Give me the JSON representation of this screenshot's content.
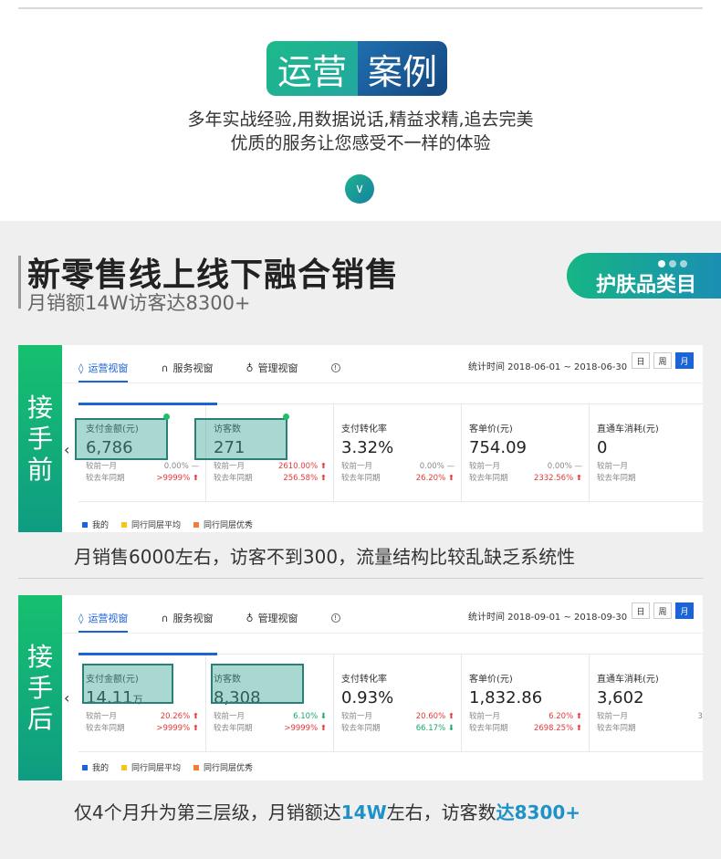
{
  "hero": {
    "badge_left": "运营",
    "badge_right": "案例",
    "subtitle_line1": "多年实战经验,用数据说话,精益求精,追去完美",
    "subtitle_line2": "优质的服务让您感受不一样的体验",
    "down_icon": "∨"
  },
  "section": {
    "title": "新零售线上线下融合销售",
    "subtitle": "月销额14W访客达8300+",
    "tag": "护肤品类目"
  },
  "panels": [
    {
      "side_label": [
        "接",
        "手",
        "前"
      ],
      "tabs": [
        "运营视窗",
        "服务视窗",
        "管理视窗"
      ],
      "stat_time": "统计时间 2018-06-01 ~ 2018-06-30",
      "period_buttons": [
        "日",
        "周",
        "月"
      ],
      "cards": [
        {
          "title": "支付金额(元)",
          "value": "6,786",
          "unit": "",
          "r1_label": "较前一月",
          "r1_val": "0.00%",
          "r1_dir": "—",
          "r2_label": "较去年同期",
          "r2_val": ">9999%",
          "r2_dir": "up"
        },
        {
          "title": "访客数",
          "value": "271",
          "unit": "",
          "r1_label": "较前一月",
          "r1_val": "2610.00%",
          "r1_dir": "up",
          "r2_label": "较去年同期",
          "r2_val": "256.58%",
          "r2_dir": "up"
        },
        {
          "title": "支付转化率",
          "value": "3.32%",
          "unit": "",
          "r1_label": "较前一月",
          "r1_val": "0.00%",
          "r1_dir": "—",
          "r2_label": "较去年同期",
          "r2_val": "26.20%",
          "r2_dir": "up"
        },
        {
          "title": "客单价(元)",
          "value": "754.09",
          "unit": "",
          "r1_label": "较前一月",
          "r1_val": "0.00%",
          "r1_dir": "—",
          "r2_label": "较去年同期",
          "r2_val": "2332.56%",
          "r2_dir": "up"
        },
        {
          "title": "直通车消耗(元)",
          "value": "0",
          "unit": "",
          "r1_label": "较前一月",
          "r1_val": "0",
          "r1_dir": "",
          "r2_label": "较去年同期",
          "r2_val": "0",
          "r2_dir": ""
        }
      ],
      "legend": [
        "我的",
        "同行同层平均",
        "同行同层优秀"
      ]
    },
    {
      "side_label": [
        "接",
        "手",
        "后"
      ],
      "tabs": [
        "运营视窗",
        "服务视窗",
        "管理视窗"
      ],
      "stat_time": "统计时间 2018-09-01 ~ 2018-09-30",
      "period_buttons": [
        "日",
        "周",
        "月"
      ],
      "cards": [
        {
          "title": "支付金额(元)",
          "value": "14.11",
          "unit": "万",
          "r1_label": "较前一月",
          "r1_val": "20.26%",
          "r1_dir": "up",
          "r2_label": "较去年同期",
          "r2_val": ">9999%",
          "r2_dir": "up"
        },
        {
          "title": "访客数",
          "value": "8,308",
          "unit": "",
          "r1_label": "较前一月",
          "r1_val": "6.10%",
          "r1_dir": "down",
          "r2_label": "较去年同期",
          "r2_val": ">9999%",
          "r2_dir": "up"
        },
        {
          "title": "支付转化率",
          "value": "0.93%",
          "unit": "",
          "r1_label": "较前一月",
          "r1_val": "20.60%",
          "r1_dir": "up",
          "r2_label": "较去年同期",
          "r2_val": "66.17%",
          "r2_dir": "down"
        },
        {
          "title": "客单价(元)",
          "value": "1,832.86",
          "unit": "",
          "r1_label": "较前一月",
          "r1_val": "6.20%",
          "r1_dir": "up",
          "r2_label": "较去年同期",
          "r2_val": "2698.25%",
          "r2_dir": "up"
        },
        {
          "title": "直通车消耗(元)",
          "value": "3,602",
          "unit": "",
          "r1_label": "较前一月",
          "r1_val": "31.",
          "r1_dir": "",
          "r2_label": "较去年同期",
          "r2_val": "0.",
          "r2_dir": ""
        }
      ],
      "legend": [
        "我的",
        "同行同层平均",
        "同行同层优秀"
      ]
    }
  ],
  "captions": {
    "before": "月销售6000左右，访客不到300，流量结构比较乱缺乏系统性",
    "after_part1": "仅4个月升为第三层级，月销额达",
    "after_hl1": "14W",
    "after_part2": "左右，访客数",
    "after_hl2": "达8300+"
  },
  "colors": {
    "accent_blue": "#1c63d6",
    "green": "#16b585",
    "up": "#e53a3a",
    "down": "#1aa86b",
    "legend": [
      "#1c63d6",
      "#f5c518",
      "#f07d3a"
    ]
  }
}
